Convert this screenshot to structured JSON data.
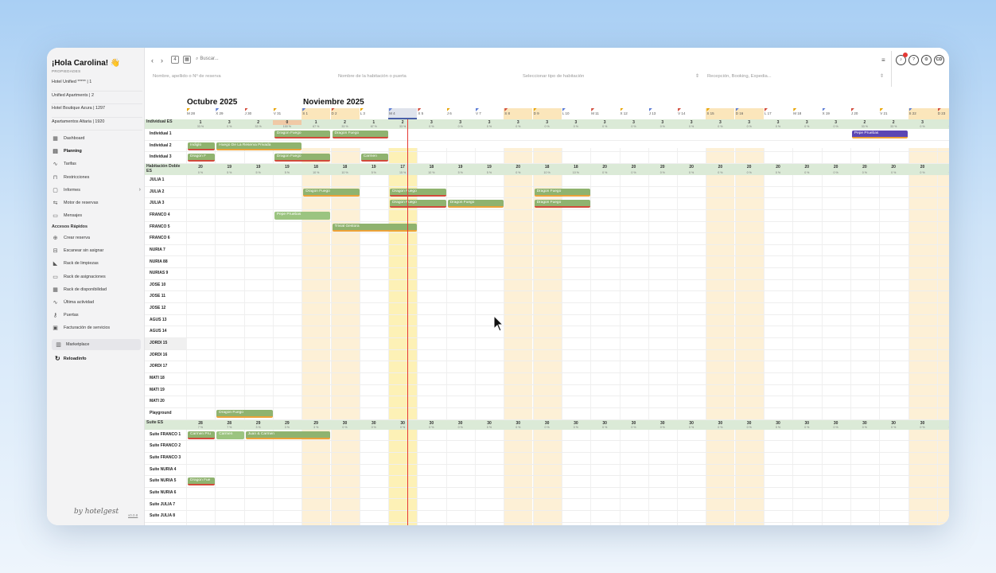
{
  "sidebar": {
    "greeting": "¡Hola Carolina! 👋",
    "properties_label": "PROPIEDADES",
    "properties": [
      "Hotel Unified ***** | 1",
      "Unified Apartments | 2",
      "Hotel Boutique Azura | 1297",
      "Apartamentos Altaria | 1920"
    ],
    "menu": [
      {
        "label": "Dashboard",
        "icon": "dashboard-icon",
        "glyph": "▦"
      },
      {
        "label": "Planning",
        "icon": "calendar-icon",
        "glyph": "▤",
        "active": true
      },
      {
        "label": "Tarifas",
        "icon": "trend-icon",
        "glyph": "∿"
      },
      {
        "label": "Restricciones",
        "icon": "lock-icon",
        "glyph": "⊓"
      },
      {
        "label": "Informes",
        "icon": "report-icon",
        "glyph": "▢",
        "chevron": "›"
      },
      {
        "label": "Motor de reservas",
        "icon": "motor-icon",
        "glyph": "⇆"
      },
      {
        "label": "Mensajes",
        "icon": "message-icon",
        "glyph": "▭"
      }
    ],
    "quick_title": "Accesos Rápidos",
    "quick": [
      {
        "label": "Crear reserva",
        "icon": "plus-circle-icon",
        "glyph": "⊕"
      },
      {
        "label": "Escanear sin asignar",
        "icon": "scan-icon",
        "glyph": "⊟"
      },
      {
        "label": "Rack de limpiezas",
        "icon": "broom-icon",
        "glyph": "◣"
      },
      {
        "label": "Rack de asignaciones",
        "icon": "assign-icon",
        "glyph": "▭"
      },
      {
        "label": "Rack de disponibilidad",
        "icon": "availability-icon",
        "glyph": "▦"
      },
      {
        "label": "Última actividad",
        "icon": "activity-icon",
        "glyph": "∿"
      },
      {
        "label": "Puertas",
        "icon": "key-icon",
        "glyph": "⚷"
      },
      {
        "label": "Facturación de servicios",
        "icon": "billing-icon",
        "glyph": "▣"
      }
    ],
    "marketplace": "Marketplace",
    "reload": "Reloadinfo",
    "brand": "by hotelgest",
    "version": "v0.0.8"
  },
  "topbar": {
    "search_placeholder": "Buscar...",
    "filter_guest": "Nombre, apellido o Nº de reserva",
    "filter_room": "Nombre de la habitación o puerta",
    "filter_type": "Seleccionar tipo de habitación",
    "filter_channel": "Recepción, Booking, Expedia...",
    "help": "?",
    "avatar": "CD",
    "notification_count": "1"
  },
  "calendar": {
    "months": [
      "Octubre 2025",
      "Noviembre 2025"
    ],
    "days": [
      "M 28",
      "X 29",
      "J 30",
      "V 31",
      "S 1",
      "D 2",
      "L 3",
      "M 4",
      "X 5",
      "J 6",
      "V 7",
      "S 8",
      "D 9",
      "L 10",
      "M 11",
      "X 12",
      "J 13",
      "V 14",
      "S 15",
      "D 16",
      "L 17",
      "M 18",
      "X 19",
      "J 20",
      "V 21",
      "S 22",
      "D 23"
    ],
    "weekend_indices": [
      4,
      5,
      11,
      12,
      18,
      19,
      25,
      26
    ],
    "today_index": 7,
    "sections": [
      {
        "name": "Individual ES",
        "counts": [
          "1",
          "3",
          "2",
          "0",
          "1",
          "2",
          "1",
          "2",
          "3",
          "3",
          "3",
          "3",
          "3",
          "3",
          "3",
          "3",
          "3",
          "3",
          "3",
          "3",
          "3",
          "3",
          "3",
          "2",
          "2",
          "3",
          "3"
        ],
        "pcts": [
          "33 %",
          "0 %",
          "33 %",
          "100 %",
          "67 %",
          "33 %",
          "67 %",
          "33 %",
          "0 %",
          "0 %",
          "0 %",
          "0 %",
          "0 %",
          "0 %",
          "0 %",
          "0 %",
          "0 %",
          "0 %",
          "0 %",
          "0 %",
          "0 %",
          "0 %",
          "0 %",
          "33 %",
          "33 %",
          "0 %",
          "0 %"
        ],
        "rooms": [
          "Individual 1",
          "Individual 2",
          "Individual 3"
        ]
      },
      {
        "name": "Habitación Doble ES",
        "counts": [
          "20",
          "19",
          "19",
          "19",
          "18",
          "18",
          "19",
          "17",
          "18",
          "19",
          "19",
          "20",
          "18",
          "18",
          "20",
          "20",
          "20",
          "20",
          "20",
          "20",
          "20",
          "20",
          "20",
          "20",
          "20",
          "20",
          "20"
        ],
        "pcts": [
          "0 %",
          "5 %",
          "5 %",
          "5 %",
          "10 %",
          "10 %",
          "5 %",
          "15 %",
          "10 %",
          "5 %",
          "5 %",
          "0 %",
          "10 %",
          "10 %",
          "0 %",
          "0 %",
          "0 %",
          "0 %",
          "0 %",
          "0 %",
          "0 %",
          "0 %",
          "0 %",
          "0 %",
          "0 %",
          "0 %",
          "0 %"
        ],
        "rooms": [
          "JULIA 1",
          "JULIA 2",
          "JULIA 3",
          "FRANCO 4",
          "FRANCO 5",
          "FRANCO 6",
          "NURIA 7",
          "NURIA 88",
          "NURIAS 9",
          "JOSE 10",
          "JOSE 11",
          "JOSE 12",
          "AGUS 13",
          "AGUS 14",
          "JORDI 15",
          "JORDI 16",
          "JORDI 17",
          "MATI 18",
          "MATI 19",
          "MATI 20",
          "Playground"
        ]
      },
      {
        "name": "Suite ES",
        "counts": [
          "28",
          "28",
          "29",
          "29",
          "29",
          "30",
          "30",
          "30",
          "30",
          "30",
          "30",
          "30",
          "30",
          "30",
          "30",
          "30",
          "30",
          "30",
          "30",
          "30",
          "30",
          "30",
          "30",
          "30",
          "30",
          "30",
          "30"
        ],
        "pcts": [
          "7 %",
          "7 %",
          "3 %",
          "3 %",
          "3 %",
          "0 %",
          "0 %",
          "0 %",
          "0 %",
          "0 %",
          "0 %",
          "0 %",
          "0 %",
          "0 %",
          "0 %",
          "0 %",
          "0 %",
          "0 %",
          "0 %",
          "0 %",
          "0 %",
          "0 %",
          "0 %",
          "0 %",
          "0 %",
          "0 %",
          "0 %"
        ],
        "rooms": [
          "Suite FRANCO 1",
          "Suite FRANCO 2",
          "Suite FRANCO 3",
          "Suite NURIA 4",
          "Suite NURIA 5",
          "Suite NURIA 6",
          "Suite JULIA 7",
          "Suite JULIA 8"
        ]
      }
    ],
    "bookings": [
      {
        "room": "Individual 1",
        "label": "Dragon Fuego",
        "start": 3,
        "span": 2,
        "style": "green"
      },
      {
        "room": "Individual 1",
        "label": "Dragon Fuego",
        "start": 5,
        "span": 2,
        "style": "green"
      },
      {
        "room": "Individual 1",
        "label": "Pepe Pruebas",
        "start": 23,
        "span": 2,
        "style": "purple"
      },
      {
        "room": "Individual 2",
        "label": "Indiglo",
        "start": 0,
        "span": 1,
        "style": "green"
      },
      {
        "room": "Individual 2",
        "label": "Huego De La Reserva Privada",
        "start": 1,
        "span": 3,
        "style": "green orange"
      },
      {
        "room": "Individual 3",
        "label": "Dragon F",
        "start": 0,
        "span": 1,
        "style": "green"
      },
      {
        "room": "Individual 3",
        "label": "Dragon Fuego",
        "start": 3,
        "span": 2,
        "style": "green"
      },
      {
        "room": "Individual 3",
        "label": "Carmen",
        "start": 6,
        "span": 1,
        "style": "green"
      },
      {
        "room": "JULIA 2",
        "label": "Dragon Fuego",
        "start": 4,
        "span": 2,
        "style": "green orange"
      },
      {
        "room": "JULIA 2",
        "label": "Dragon Fuego",
        "start": 7,
        "span": 2,
        "style": "green"
      },
      {
        "room": "JULIA 2",
        "label": "Dragon Fuego",
        "start": 12,
        "span": 2,
        "style": "green orange"
      },
      {
        "room": "JULIA 3",
        "label": "Dragon Fuego",
        "start": 7,
        "span": 2,
        "style": "green"
      },
      {
        "room": "JULIA 3",
        "label": "Dragon Fuego",
        "start": 9,
        "span": 2,
        "style": "green orange"
      },
      {
        "room": "JULIA 3",
        "label": "Dragon Fuego",
        "start": 12,
        "span": 2,
        "style": "green"
      },
      {
        "room": "FRANCO 4",
        "label": "Pepe Pruebas",
        "start": 3,
        "span": 2,
        "style": "light"
      },
      {
        "room": "FRANCO 5",
        "label": "Trivial Gestora",
        "start": 5,
        "span": 3,
        "style": "green orange"
      },
      {
        "room": "Playground",
        "label": "Dragon Fuego",
        "start": 1,
        "span": 2,
        "style": "green orange"
      },
      {
        "room": "Suite FRANCO 1",
        "label": "Carmen Pru",
        "start": 0,
        "span": 1,
        "style": "green"
      },
      {
        "room": "Suite FRANCO 1",
        "label": "Carmen",
        "start": 1,
        "span": 1,
        "style": "light"
      },
      {
        "room": "Suite FRANCO 1",
        "label": "Juan & Carmen",
        "start": 2,
        "span": 3,
        "style": "green orange"
      },
      {
        "room": "Suite NURIA 5",
        "label": "Dragon Fue",
        "start": 0,
        "span": 1,
        "style": "green"
      }
    ]
  }
}
